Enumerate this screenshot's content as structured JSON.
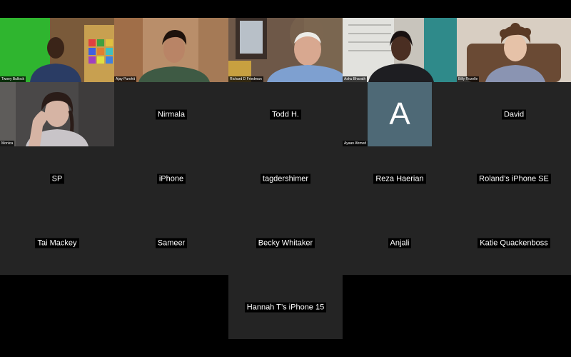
{
  "video_participants": [
    {
      "name": "Twoey Bullock"
    },
    {
      "name": "Ajay Purohit"
    },
    {
      "name": "Richard D Friedman"
    },
    {
      "name": "Ashu Bharath"
    },
    {
      "name": "Billy Rozelle"
    },
    {
      "name": "Monica"
    }
  ],
  "avatar_participant": {
    "name": "Ayaan Ahmed",
    "initial": "A",
    "color": "#4e6976"
  },
  "name_only_participants": [
    {
      "name": "Nirmala"
    },
    {
      "name": "Todd H."
    },
    {
      "name": "David"
    },
    {
      "name": "SP"
    },
    {
      "name": "iPhone"
    },
    {
      "name": "tagdershimer"
    },
    {
      "name": "Reza Haerian"
    },
    {
      "name": "Roland’s iPhone SE"
    },
    {
      "name": "Tai Mackey"
    },
    {
      "name": "Sameer"
    },
    {
      "name": "Becky Whitaker"
    },
    {
      "name": "Anjali"
    },
    {
      "name": "Katie Quackenboss"
    },
    {
      "name": "Hannah T’s iPhone 15"
    }
  ]
}
